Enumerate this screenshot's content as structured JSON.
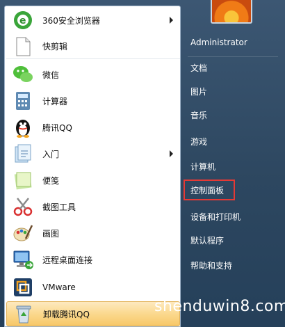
{
  "programs": [
    {
      "label": "360安全浏览器",
      "icon": "browser-360-icon",
      "submenu": true
    },
    {
      "label": "快剪辑",
      "icon": "document-icon",
      "submenu": false
    },
    {
      "label": "微信",
      "icon": "wechat-icon",
      "submenu": false
    },
    {
      "label": "计算器",
      "icon": "calculator-icon",
      "submenu": false
    },
    {
      "label": "腾讯QQ",
      "icon": "qq-penguin-icon",
      "submenu": false
    },
    {
      "label": "入门",
      "icon": "getting-started-icon",
      "submenu": true
    },
    {
      "label": "便笺",
      "icon": "sticky-notes-icon",
      "submenu": false
    },
    {
      "label": "截图工具",
      "icon": "snipping-tool-icon",
      "submenu": false
    },
    {
      "label": "画图",
      "icon": "paint-icon",
      "submenu": false
    },
    {
      "label": "远程桌面连接",
      "icon": "remote-desktop-icon",
      "submenu": false
    },
    {
      "label": "VMware",
      "icon": "vmware-icon",
      "submenu": false
    },
    {
      "label": "卸载腾讯QQ",
      "icon": "recycle-bin-icon",
      "submenu": false
    }
  ],
  "right_menu": {
    "user": "Administrator",
    "items": [
      "文档",
      "图片",
      "音乐",
      "游戏",
      "计算机",
      "控制面板",
      "设备和打印机",
      "默认程序",
      "帮助和支持"
    ],
    "highlighted": "控制面板"
  },
  "watermark": "shenduwin8.com",
  "colors": {
    "highlight_box": "#e53935",
    "hover": "#fbd98e"
  }
}
